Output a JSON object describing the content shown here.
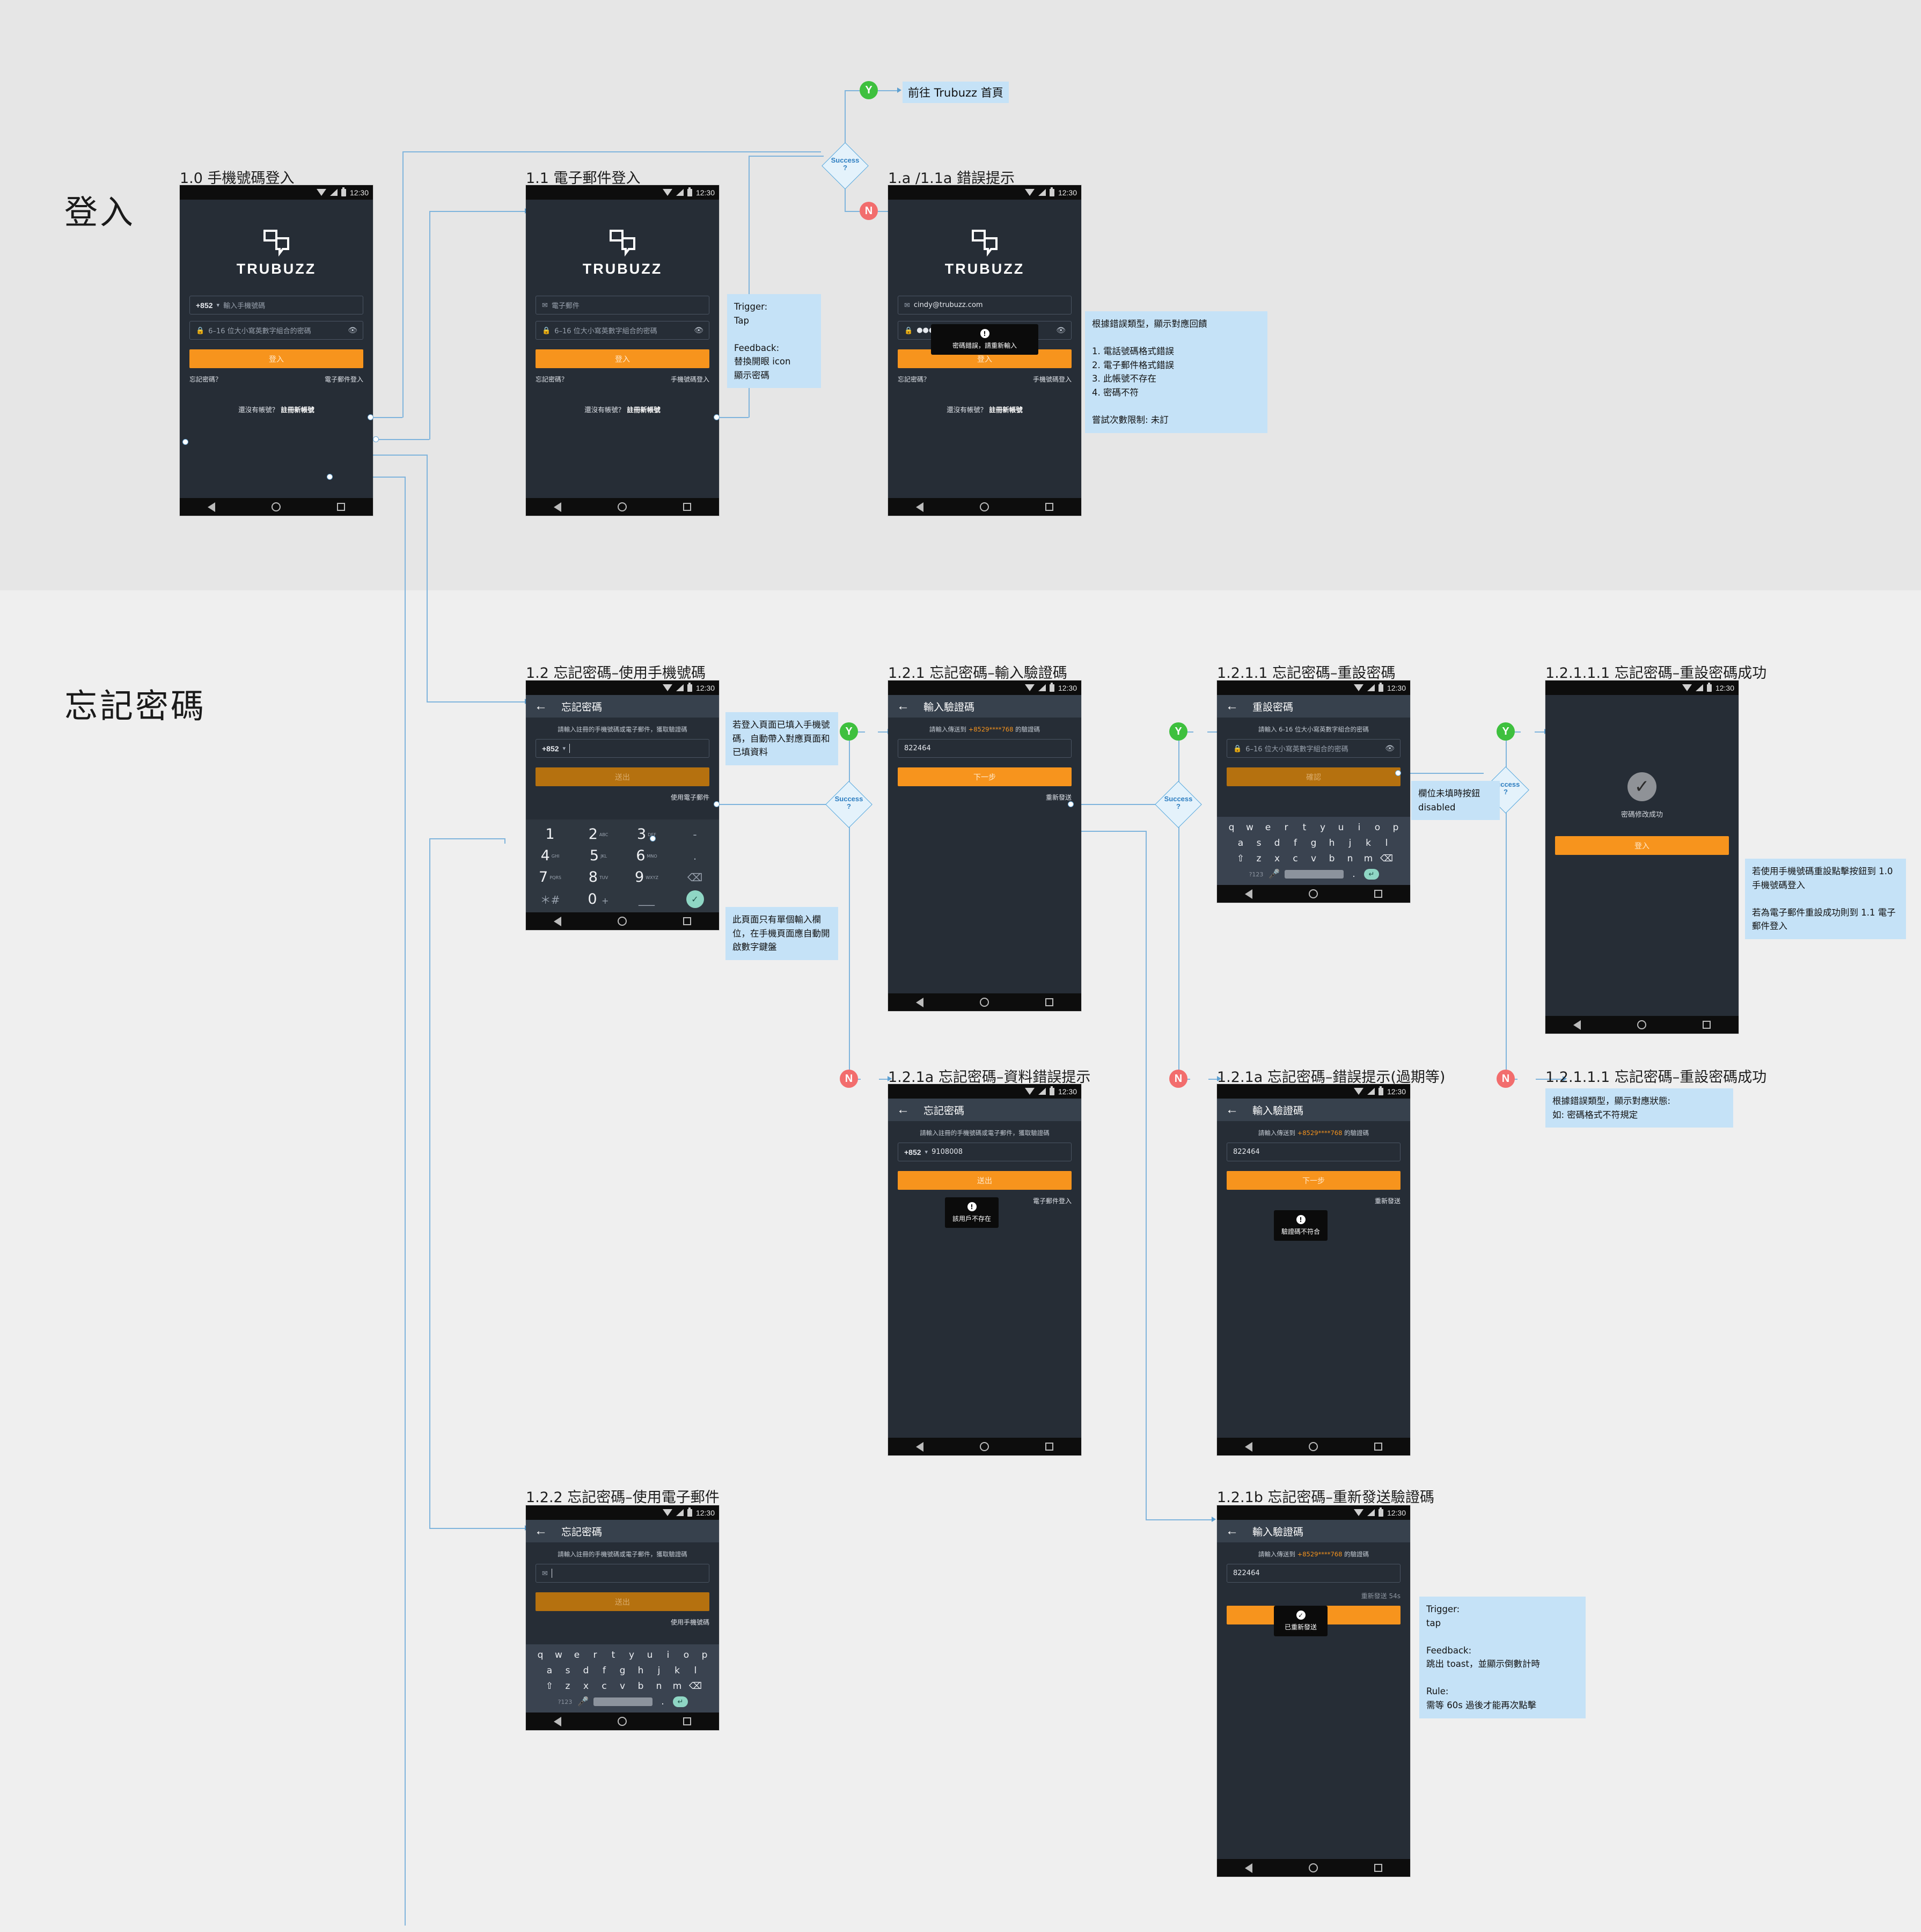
{
  "sections": {
    "login": "登入",
    "forgot": "忘記密碼"
  },
  "common": {
    "status_time": "12:30",
    "brand": "TRUBUZZ",
    "password_placeholder": "6–16 位大小寫英數字組合的密碼",
    "forgot_link": "忘記密碼？",
    "signup_prefix": "還沒有帳號？",
    "signup_link": "註冊新帳號",
    "login_button": "登入",
    "submit_button": "送出",
    "next_button": "下一步",
    "confirm_button": "確認",
    "resend_link": "重新發送",
    "forgot_hint": "請輸入註冊的手機號碼或電子郵件，獲取驗證碼",
    "code_hint_prefix": "請輸入傳送到",
    "code_hint_phone": "+8529****768",
    "code_hint_suffix": "的驗證碼",
    "code_value": "822464",
    "country_code": "+852",
    "reset_hint": "請輸入 6-16 位大小寫英數字組合的密碼"
  },
  "screens": {
    "s10": {
      "label": "1.0 手機號碼登入",
      "phone_placeholder": "輸入手機號碼",
      "email_login_link": "電子郵件登入"
    },
    "s11": {
      "label": "1.1 電子郵件登入",
      "email_placeholder": "電子郵件",
      "phone_login_link": "手機號碼登入"
    },
    "s1a": {
      "label": "1.a /1.1a 錯誤提示",
      "email_value": "cindy@trubuzz.com",
      "password_masked": "●●●●●●●●",
      "toast": "密碼錯誤，請重新輸入",
      "phone_login_link": "手機號碼登入"
    },
    "s12": {
      "label": "1.2 忘記密碼–使用手機號碼",
      "nav_title": "忘記密碼",
      "use_email_link": "使用電子郵件"
    },
    "s121": {
      "label": "1.2.1 忘記密碼–輸入驗證碼",
      "nav_title": "輸入驗證碼"
    },
    "s1211": {
      "label": "1.2.1.1 忘記密碼–重設密碼",
      "nav_title": "重設密碼"
    },
    "s12111": {
      "label": "1.2.1.1.1 忘記密碼–重設密碼成功",
      "success_text": "密碼修改成功"
    },
    "s121a_data": {
      "label": "1.2.1a 忘記密碼–資料錯誤提示",
      "nav_title": "忘記密碼",
      "phone_value": "9108008",
      "toast": "該用戶不存在",
      "email_login_link": "電子郵件登入"
    },
    "s121a_code": {
      "label": "1.2.1a 忘記密碼–錯誤提示(過期等)",
      "nav_title": "輸入驗證碼",
      "toast": "驗證碼不符合"
    },
    "s12111_err": {
      "label": "1.2.1.1.1 忘記密碼–重設密碼成功"
    },
    "s122": {
      "label": "1.2.2 忘記密碼–使用電子郵件",
      "nav_title": "忘記密碼",
      "use_phone_link": "使用手機號碼"
    },
    "s121b": {
      "label": "1.2.1b 忘記密碼–重新發送驗證碼",
      "nav_title": "輸入驗證碼",
      "resend_countdown": "重新發送 54s",
      "toast": "已重新發送"
    }
  },
  "flow": {
    "decision_label_1": "Success",
    "decision_label_2": "?",
    "yes": "Y",
    "no": "N",
    "goto_home": "前往 Trubuzz 首頁"
  },
  "notes": {
    "eye_toggle": "Trigger:\nTap\n\nFeedback:\n替換開眼 icon\n顯示密碼",
    "login_errors": "根據錯誤類型，顯示對應回饋\n\n1. 電話號碼格式錯誤\n2. 電子郵件格式錯誤\n3. 此帳號不存在\n4. 密碼不符\n\n嘗試次數限制: 未訂",
    "prefill": "若登入頁面已填入手機號碼，自動帶入對應頁面和已填資料",
    "numeric_keyboard": "此頁面只有單個輸入欄位，在手機頁面應自動開啟數字鍵盤",
    "disabled_button": "欄位未填時按鈕 disabled",
    "reset_success_routing": "若使用手機號碼重設點擊按鈕到 1.0 手機號碼登入\n\n若為電子郵件重設成功則到 1.1 電子郵件登入",
    "reset_error": "根據錯誤類型，顯示對應狀態:\n如: 密碼格式不符規定",
    "resend_rule": "Trigger:\ntap\n\nFeedback:\n跳出 toast，並顯示倒數計時\n\nRule:\n需等 60s 過後才能再次點擊"
  },
  "keyboard": {
    "row1": [
      "q",
      "w",
      "e",
      "r",
      "t",
      "y",
      "u",
      "i",
      "o",
      "p"
    ],
    "row2": [
      "a",
      "s",
      "d",
      "f",
      "g",
      "h",
      "j",
      "k",
      "l"
    ],
    "row3": [
      "z",
      "x",
      "c",
      "v",
      "b",
      "n",
      "m"
    ],
    "numsym": "?123",
    "period": "."
  },
  "numpad": {
    "r1": [
      "1",
      "2",
      "3",
      "-"
    ],
    "r2": [
      "4",
      "5",
      "6",
      "."
    ],
    "r3": [
      "7",
      "8",
      "9",
      "⌫"
    ],
    "r4": [
      "＊#",
      "0 +",
      "___",
      "✓"
    ],
    "sub2": "ABC",
    "sub3": "DEF",
    "sub4": "GHI",
    "sub5": "JKL",
    "sub6": "MNO",
    "sub7": "PQRS",
    "sub8": "TUV",
    "sub9": "WXYZ"
  }
}
